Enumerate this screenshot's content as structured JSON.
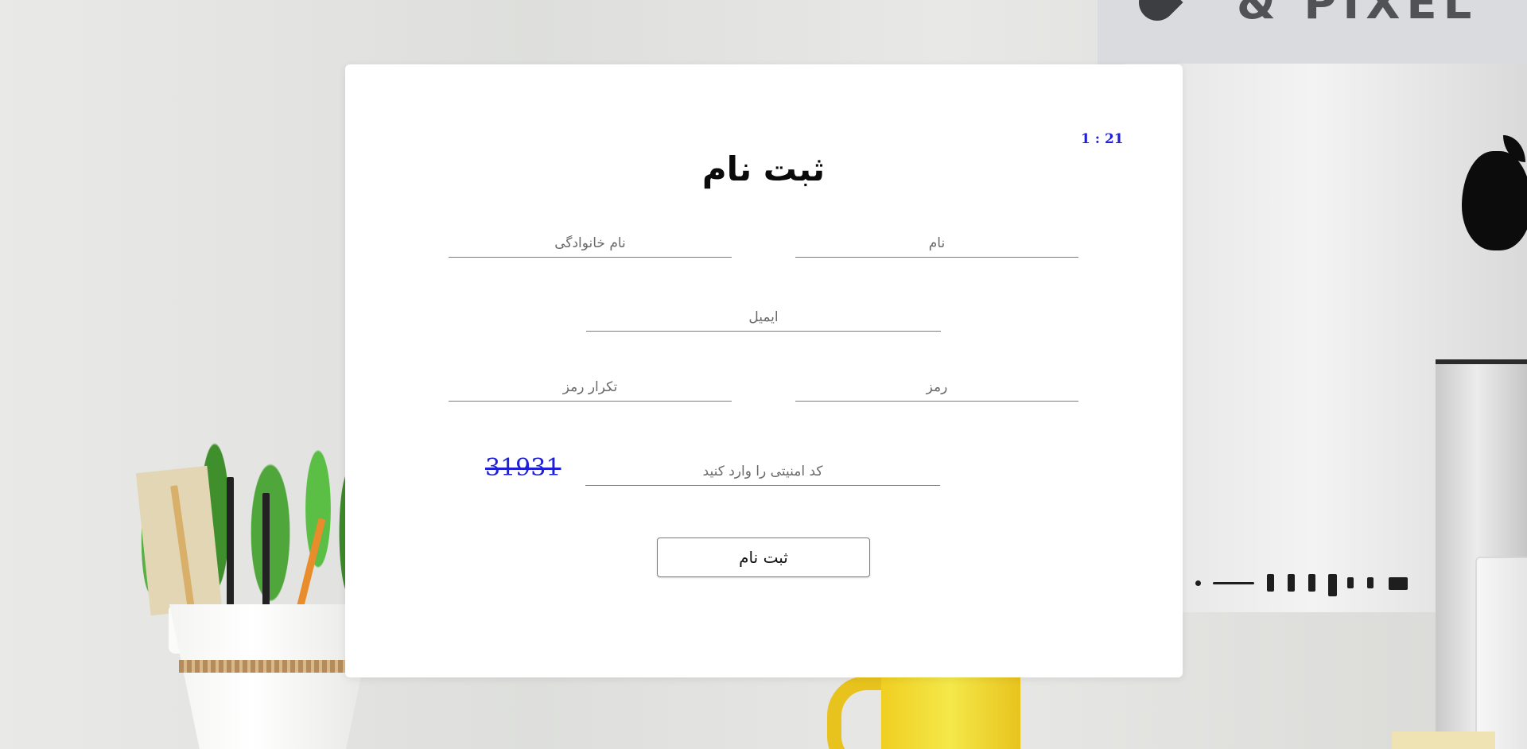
{
  "background": {
    "brand_text": "& PIXEL"
  },
  "form": {
    "timer": "1 : 21",
    "title": "ثبت نام",
    "first_name_placeholder": "نام",
    "last_name_placeholder": "نام خانوادگی",
    "email_placeholder": "ایمیل",
    "password_placeholder": "رمز",
    "password_repeat_placeholder": "تکرار رمز",
    "captcha_placeholder": "کد امنیتی را وارد کنید",
    "captcha_code": "31931",
    "submit_label": "ثبت نام"
  },
  "colors": {
    "timer": "#1f1fd6",
    "captcha": "#1f1fd6",
    "card": "#ffffff",
    "underline": "#7c7c7c"
  }
}
